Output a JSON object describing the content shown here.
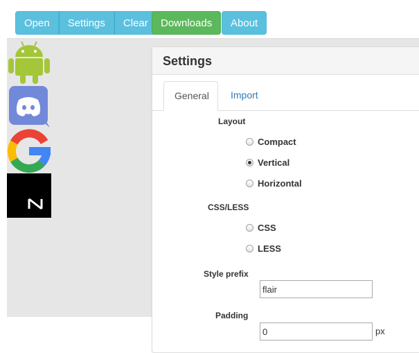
{
  "toolbar": {
    "buttons": [
      {
        "label": "Open"
      },
      {
        "label": "Settings"
      },
      {
        "label": "Clear"
      },
      {
        "label": "Downloads"
      },
      {
        "label": "About"
      }
    ],
    "colors": {
      "info": "#5bc0de",
      "success": "#5cb85c"
    }
  },
  "launcher": {
    "icons": [
      "android-icon",
      "discord-icon",
      "google-icon",
      "notion-icon"
    ]
  },
  "settings_panel": {
    "title": "Settings",
    "tabs": [
      {
        "label": "General",
        "active": true
      },
      {
        "label": "Import",
        "active": false
      }
    ],
    "layout": {
      "label": "Layout",
      "options": [
        "Compact",
        "Vertical",
        "Horizontal"
      ],
      "selected": "Vertical"
    },
    "css_less": {
      "label": "CSS/LESS",
      "options": [
        "CSS",
        "LESS"
      ],
      "selected": null
    },
    "style_prefix": {
      "label": "Style prefix",
      "value": "flair"
    },
    "padding": {
      "label": "Padding",
      "value": "0",
      "unit": "px"
    }
  }
}
